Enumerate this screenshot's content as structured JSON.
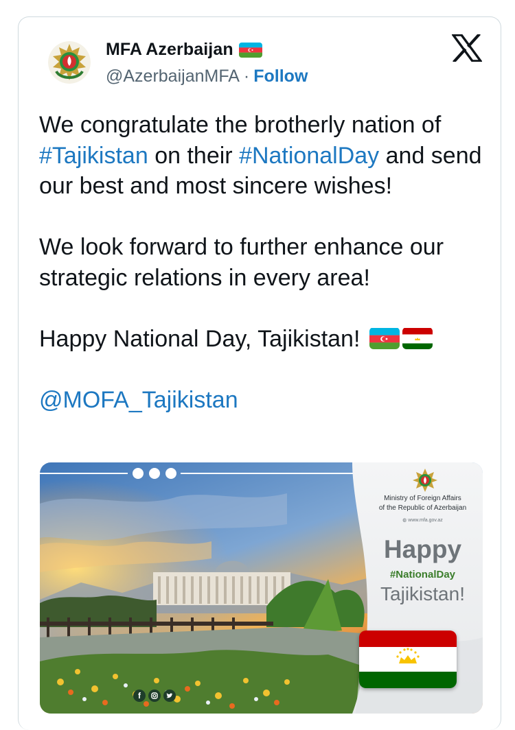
{
  "author": {
    "display_name": "MFA Azerbaijan",
    "handle": "@AzerbaijanMFA",
    "separator": "·",
    "follow_label": "Follow"
  },
  "tweet": {
    "p1_a": "We congratulate the brotherly nation of ",
    "p1_tag1": "#Tajikistan",
    "p1_b": " on their ",
    "p1_tag2": "#NationalDay",
    "p1_c": " and send our best and most sincere wishes!",
    "p2": "We look forward to further enhance our strategic relations in every area!",
    "p3": "Happy National Day, Tajikistan!",
    "mention": "@MOFA_Tajikistan"
  },
  "media": {
    "ministry_line1": "Ministry of Foreign Affairs",
    "ministry_line2": "of the Republic of Azerbaijan",
    "website": "www.mfa.gov.az",
    "happy": "Happy",
    "hashtag": "#NationalDay",
    "country": "Tajikistan!"
  },
  "colors": {
    "link": "#1d78c1",
    "text": "#0f1419",
    "secondary": "#536471",
    "az_blue": "#00b5e2",
    "az_red": "#ef3340",
    "az_green": "#509e2f",
    "tj_red": "#cc0000",
    "tj_green": "#006600",
    "tj_gold": "#f8c300"
  },
  "icons": [
    "x-logo-icon",
    "azerbaijan-flag-icon",
    "tajikistan-flag-icon",
    "facebook-icon",
    "instagram-icon",
    "twitter-icon"
  ]
}
